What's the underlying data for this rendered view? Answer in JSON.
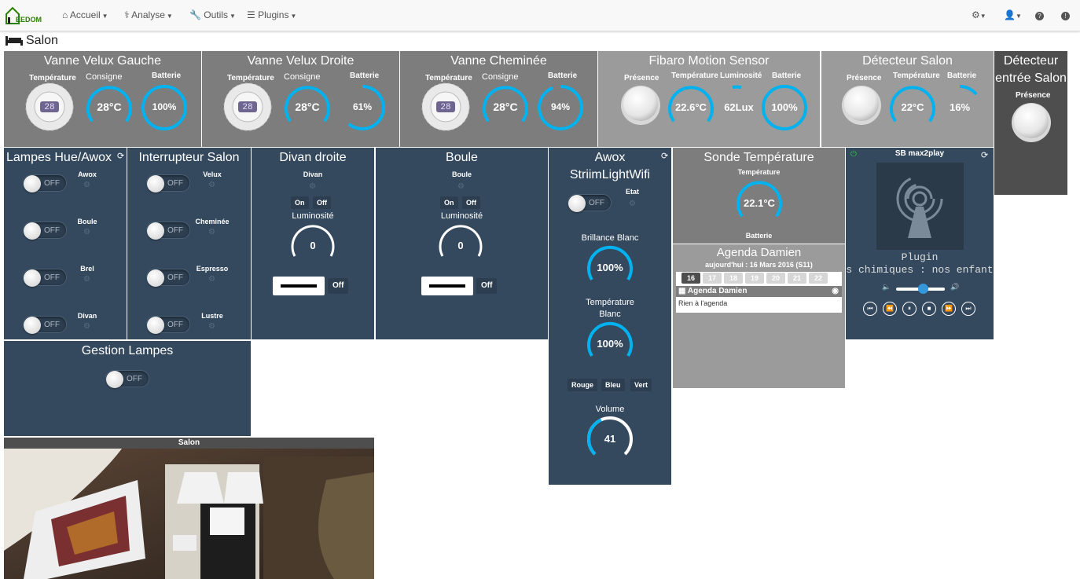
{
  "nav": {
    "logo": "EEDOM",
    "items": [
      "Accueil",
      "Analyse",
      "Outils",
      "Plugins"
    ]
  },
  "page": {
    "title": "Salon"
  },
  "valves": [
    {
      "title": "Vanne Velux Gauche",
      "temp_label": "Température",
      "thermo_value": "28",
      "consigne_label": "Consigne",
      "consigne": "28°C",
      "battery_label": "Batterie",
      "battery": "100%",
      "battery_pct": 100
    },
    {
      "title": "Vanne Velux Droite",
      "temp_label": "Température",
      "thermo_value": "28",
      "consigne_label": "Consigne",
      "consigne": "28°C",
      "battery_label": "Batterie",
      "battery": "61%",
      "battery_pct": 61
    },
    {
      "title": "Vanne Cheminée",
      "temp_label": "Température",
      "thermo_value": "28",
      "consigne_label": "Consigne",
      "consigne": "28°C",
      "battery_label": "Batterie",
      "battery": "94%",
      "battery_pct": 94
    }
  ],
  "fibaro": {
    "title": "Fibaro Motion Sensor",
    "presence_label": "Présence",
    "temp_label": "Température",
    "temp": "22.6°C",
    "lum_label": "Luminosité",
    "lum": "62Lux",
    "battery_label": "Batterie",
    "battery": "100%"
  },
  "detecteur_salon": {
    "title": "Détecteur Salon",
    "presence_label": "Présence",
    "temp_label": "Température",
    "temp": "22°C",
    "battery_label": "Batterie",
    "battery": "16%"
  },
  "detecteur_entree": {
    "title_line1": "Détecteur",
    "title_line2": "entrée Salon",
    "presence_label": "Présence"
  },
  "lampes": {
    "title": "Lampes Hue/Awox",
    "items": [
      {
        "label": "Awox",
        "state": "OFF"
      },
      {
        "label": "Boule",
        "state": "OFF"
      },
      {
        "label": "Brel",
        "state": "OFF"
      },
      {
        "label": "Divan",
        "state": "OFF"
      }
    ]
  },
  "interrupteur": {
    "title": "Interrupteur Salon",
    "items": [
      {
        "label": "Velux",
        "state": "OFF"
      },
      {
        "label": "Cheminée",
        "state": "OFF"
      },
      {
        "label": "Espresso",
        "state": "OFF"
      },
      {
        "label": "Lustre",
        "state": "OFF"
      }
    ]
  },
  "divan": {
    "title": "Divan droite",
    "sub": "Divan",
    "on": "On",
    "off": "Off",
    "lum_label": "Luminosité",
    "lum": "0",
    "color_off": "Off"
  },
  "boule": {
    "title": "Boule",
    "sub": "Boule",
    "on": "On",
    "off": "Off",
    "lum_label": "Luminosité",
    "lum": "0",
    "color_off": "Off"
  },
  "awox": {
    "title_line1": "Awox",
    "title_line2": "StriimLightWifi",
    "etat_label": "Etat",
    "state": "OFF",
    "brillance_label": "Brillance Blanc",
    "brillance": "100%",
    "temp_label_1": "Température",
    "temp_label_2": "Blanc",
    "temp": "100%",
    "rouge": "Rouge",
    "bleu": "Bleu",
    "vert": "Vert",
    "volume_label": "Volume",
    "volume": "41",
    "volume_pct": 41
  },
  "sonde": {
    "title": "Sonde Température",
    "temp_label": "Température",
    "temp": "22.1°C",
    "battery_label": "Batterie"
  },
  "agenda": {
    "title": "Agenda Damien",
    "today": "aujourd'hui : 16 Mars 2016 (S11)",
    "days": [
      "16",
      "17",
      "18",
      "19",
      "20",
      "21",
      "22"
    ],
    "calendar_name": "Agenda Damien",
    "empty": "Rien à l'agenda"
  },
  "sb": {
    "title": "SB max2play",
    "plugin": "Plugin",
    "scroll_text": "s chimiques : nos enfant",
    "volume_pct": 55
  },
  "gestion": {
    "title": "Gestion Lampes",
    "state": "OFF"
  },
  "camera": {
    "title": "Salon"
  },
  "colors": {
    "grey": "#7d7d7d",
    "light_grey": "#9b9b9b",
    "dark_blue": "#34495e",
    "gauge": "#00b2ef",
    "dark": "#4e4e4e"
  }
}
